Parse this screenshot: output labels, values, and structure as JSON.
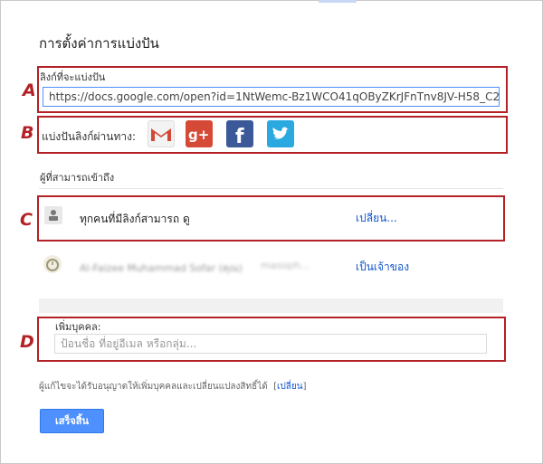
{
  "dialog": {
    "title": "การตั้งค่าการแบ่งปัน"
  },
  "annotations": {
    "a": "A",
    "b": "B",
    "c": "C",
    "d": "D"
  },
  "link_section": {
    "label": "ลิงก์ที่จะแบ่งปัน",
    "url": "https://docs.google.com/open?id=1NtWemc-Bz1WCO41qOByZKrJFnTnv8JV-H58_C2"
  },
  "share_via": {
    "label": "แบ่งปันลิงก์ผ่านทาง:",
    "services": [
      {
        "name": "Gmail",
        "icon": "gmail-icon",
        "color": "#d14836"
      },
      {
        "name": "Google+",
        "icon": "google-plus-icon",
        "color": "#d64937"
      },
      {
        "name": "Facebook",
        "icon": "facebook-icon",
        "color": "#3b5998"
      },
      {
        "name": "Twitter",
        "icon": "twitter-icon",
        "color": "#2aa9e0"
      }
    ]
  },
  "access": {
    "header": "ผู้ที่สามารถเข้าถึง",
    "rows": [
      {
        "text": "ทุกคนที่มีลิงก์สามารถ ดู",
        "action": "เปลี่ยน..."
      },
      {
        "name": "Al-Faizee Muhammad Sofar (คุณ)",
        "email": "masoph...",
        "role": "เป็นเจ้าของ"
      }
    ]
  },
  "add_people": {
    "label": "เพิ่มบุคคล:",
    "placeholder": "ป้อนชื่อ ที่อยู่อีเมล หรือกลุ่ม..."
  },
  "footer": {
    "note": "ผู้แก้ไขจะได้รับอนุญาตให้เพิ่มบุคคลและเปลี่ยนแปลงสิทธิ์ได้",
    "change_link": "เปลี่ยน",
    "done_button": "เสร็จสิ้น"
  },
  "colors": {
    "accent": "#4d90fe",
    "annotation": "#b32025",
    "link": "#1155cc"
  }
}
